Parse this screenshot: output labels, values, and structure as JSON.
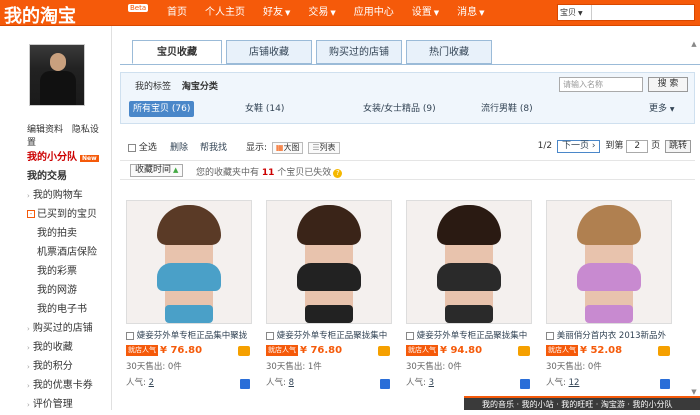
{
  "header": {
    "logo": "我的淘宝",
    "beta": "Beta",
    "nav": [
      {
        "label": "首页",
        "dropdown": false
      },
      {
        "label": "个人主页",
        "dropdown": false
      },
      {
        "label": "好友",
        "dropdown": true
      },
      {
        "label": "交易",
        "dropdown": true
      },
      {
        "label": "应用中心",
        "dropdown": false
      },
      {
        "label": "设置",
        "dropdown": true
      },
      {
        "label": "消息",
        "dropdown": true
      }
    ],
    "search": {
      "scope": "宝贝",
      "placeholder": ""
    }
  },
  "profile": {
    "edit": "编辑资料",
    "privacy": "隐私设置"
  },
  "sidebar": {
    "team": "我的小分队",
    "team_badge": "New",
    "trade": "我的交易",
    "items": [
      {
        "label": "我的购物车",
        "level": 1,
        "type": "arrow"
      },
      {
        "label": "已买到的宝贝",
        "level": 1,
        "type": "box"
      },
      {
        "label": "我的拍卖",
        "level": 2,
        "type": "none"
      },
      {
        "label": "机票酒店保险",
        "level": 2,
        "type": "none"
      },
      {
        "label": "我的彩票",
        "level": 2,
        "type": "none"
      },
      {
        "label": "我的网游",
        "level": 2,
        "type": "none"
      },
      {
        "label": "我的电子书",
        "level": 2,
        "type": "none"
      },
      {
        "label": "购买过的店铺",
        "level": 1,
        "type": "arrow"
      },
      {
        "label": "我的收藏",
        "level": 1,
        "type": "arrow"
      },
      {
        "label": "我的积分",
        "level": 1,
        "type": "arrow"
      },
      {
        "label": "我的优惠卡券",
        "level": 1,
        "type": "arrow"
      },
      {
        "label": "评价管理",
        "level": 1,
        "type": "arrow"
      }
    ]
  },
  "tabs": [
    "宝贝收藏",
    "店铺收藏",
    "购买过的店铺",
    "热门收藏"
  ],
  "filter": {
    "my_tags": "我的标签",
    "taobao_cat": "淘宝分类",
    "search_placeholder": "请输入名称",
    "search_btn": "搜 索",
    "categories": [
      {
        "label": "所有宝贝 (76)",
        "selected": true
      },
      {
        "label": "女鞋 (14)",
        "selected": false
      },
      {
        "label": "女装/女士精品 (9)",
        "selected": false
      },
      {
        "label": "流行男鞋 (8)",
        "selected": false
      }
    ],
    "more": "更多"
  },
  "toolbar": {
    "select_all": "全选",
    "delete": "删除",
    "find_similar": "帮我找",
    "display": "显示:",
    "big": "大图",
    "list": "列表",
    "page": "1/2",
    "next": "下一页",
    "goto": "到第",
    "page_input": "2",
    "page_unit": "页",
    "go": "跳转"
  },
  "sort": {
    "label": "收藏时间",
    "msg_pre": "您的收藏夹中有",
    "count": "11",
    "msg_post": "个宝贝已失效"
  },
  "products": [
    {
      "name": "婕妾芬外单专柜正品集中聚拢",
      "badge": "就店人气",
      "price": "¥ 76.80",
      "sold": "30天售出: 0件",
      "pop_label": "人气:",
      "pop": "2",
      "hair": "#5a3a26",
      "bra": "#4aa0c8",
      "pant": "#4aa0c8"
    },
    {
      "name": "婕妾芬外单专柜正品聚拢集中",
      "badge": "就店人气",
      "price": "¥ 76.80",
      "sold": "30天售出: 1件",
      "pop_label": "人气:",
      "pop": "8",
      "hair": "#3a2418",
      "bra": "#222222",
      "pant": "#222222"
    },
    {
      "name": "婕妾芬外单专柜正品聚拢集中",
      "badge": "就店人气",
      "price": "¥ 94.80",
      "sold": "30天售出: 0件",
      "pop_label": "人气:",
      "pop": "3",
      "hair": "#2a1a12",
      "bra": "#2a2a2a",
      "pant": "#2a2a2a"
    },
    {
      "name": "美丽俏分首内衣 2013新品外",
      "badge": "就店人气",
      "price": "¥ 52.08",
      "sold": "30天售出: 0件",
      "pop_label": "人气:",
      "pop": "12",
      "hair": "#b08050",
      "bra": "#c88ad0",
      "pant": "#c88ad0"
    }
  ],
  "footer": "我的音乐 · 我的小站 · 我的旺旺 · 淘宝游 · 我的小分队"
}
